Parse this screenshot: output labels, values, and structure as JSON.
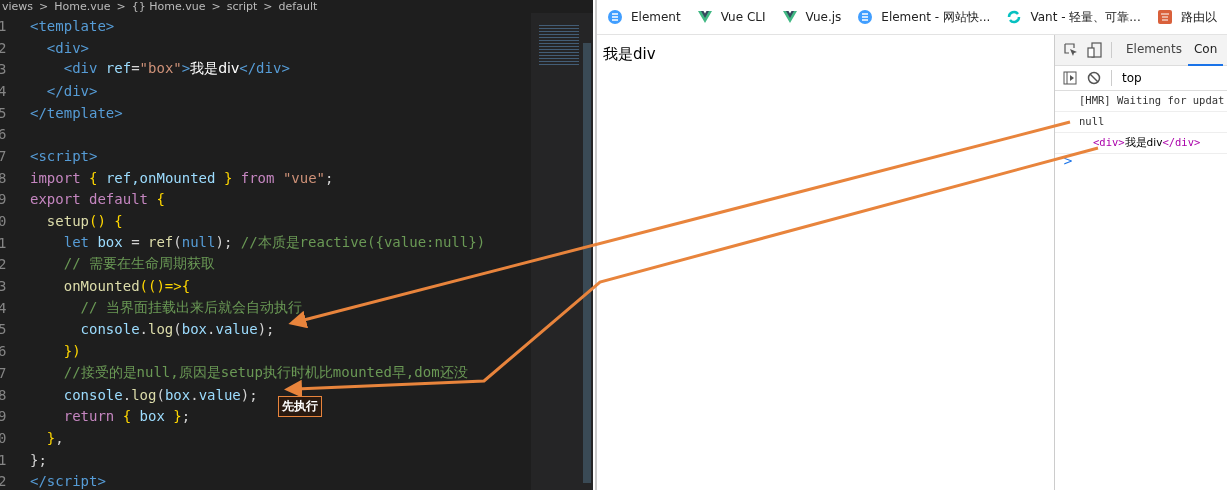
{
  "editor": {
    "breadcrumb": [
      "views",
      ">",
      "Home.vue",
      ">",
      "{} Home.vue",
      ">",
      "script",
      ">",
      "default"
    ],
    "lines": [
      {
        "number": "1",
        "tokens": [
          {
            "kind": "tag",
            "text": "<template>"
          }
        ]
      },
      {
        "number": "2",
        "tokens": [
          {
            "kind": "tag",
            "text": "  <div>"
          }
        ]
      },
      {
        "number": "3",
        "tokens": [
          {
            "kind": "tag",
            "text": "    <div "
          },
          {
            "kind": "attr",
            "text": "ref"
          },
          {
            "kind": "plain",
            "text": "="
          },
          {
            "kind": "str",
            "text": "\"box\""
          },
          {
            "kind": "tag",
            "text": ">"
          },
          {
            "kind": "text",
            "text": "我是div"
          },
          {
            "kind": "tag",
            "text": "</div>"
          }
        ]
      },
      {
        "number": "4",
        "tokens": [
          {
            "kind": "tag",
            "text": "  </div>"
          }
        ]
      },
      {
        "number": "5",
        "tokens": [
          {
            "kind": "tag",
            "text": "</template>"
          }
        ]
      },
      {
        "number": "6"
      },
      {
        "number": "7",
        "tokens": [
          {
            "kind": "tag",
            "text": "<script>"
          }
        ]
      },
      {
        "number": "8",
        "tokens": [
          {
            "kind": "kw",
            "text": "import "
          },
          {
            "kind": "brace",
            "text": "{ "
          },
          {
            "kind": "var",
            "text": "ref,onMounted "
          },
          {
            "kind": "brace",
            "text": "} "
          },
          {
            "kind": "kw",
            "text": "from "
          },
          {
            "kind": "str",
            "text": "\"vue\""
          },
          {
            "kind": "plain",
            "text": ";"
          }
        ]
      },
      {
        "number": "9",
        "tokens": [
          {
            "kind": "kw",
            "text": "export default "
          },
          {
            "kind": "brace",
            "text": "{"
          }
        ]
      },
      {
        "number": "0",
        "tokens": [
          {
            "kind": "fn",
            "text": "  setup"
          },
          {
            "kind": "brace",
            "text": "() {"
          }
        ]
      },
      {
        "number": "1",
        "tokens": [
          {
            "kind": "tag",
            "text": "    let "
          },
          {
            "kind": "var",
            "text": "box "
          },
          {
            "kind": "plain",
            "text": "= "
          },
          {
            "kind": "fn",
            "text": "ref"
          },
          {
            "kind": "plain",
            "text": "("
          },
          {
            "kind": "tag",
            "text": "null"
          },
          {
            "kind": "plain",
            "text": "); "
          },
          {
            "kind": "comment",
            "text": "//本质是reactive({value:null})"
          }
        ]
      },
      {
        "number": "2",
        "tokens": [
          {
            "kind": "comment",
            "text": "    // 需要在生命周期获取"
          }
        ]
      },
      {
        "number": "3",
        "tokens": [
          {
            "kind": "fn",
            "text": "    onMounted"
          },
          {
            "kind": "brace",
            "text": "(()=>{"
          }
        ]
      },
      {
        "number": "4",
        "tokens": [
          {
            "kind": "comment",
            "text": "      // 当界面挂载出来后就会自动执行"
          }
        ]
      },
      {
        "number": "5",
        "tokens": [
          {
            "kind": "var",
            "text": "      console"
          },
          {
            "kind": "plain",
            "text": "."
          },
          {
            "kind": "fn",
            "text": "log"
          },
          {
            "kind": "plain",
            "text": "("
          },
          {
            "kind": "var",
            "text": "box"
          },
          {
            "kind": "plain",
            "text": "."
          },
          {
            "kind": "var",
            "text": "value"
          },
          {
            "kind": "plain",
            "text": ");"
          }
        ]
      },
      {
        "number": "6",
        "tokens": [
          {
            "kind": "brace",
            "text": "    })"
          }
        ]
      },
      {
        "number": "7",
        "tokens": [
          {
            "kind": "comment",
            "text": "    //接受的是null,原因是setup执行时机比mounted早,dom还没"
          }
        ]
      },
      {
        "number": "8",
        "tokens": [
          {
            "kind": "var",
            "text": "    console"
          },
          {
            "kind": "plain",
            "text": "."
          },
          {
            "kind": "fn",
            "text": "log"
          },
          {
            "kind": "plain",
            "text": "("
          },
          {
            "kind": "var",
            "text": "box"
          },
          {
            "kind": "plain",
            "text": "."
          },
          {
            "kind": "var",
            "text": "value"
          },
          {
            "kind": "plain",
            "text": ");"
          }
        ]
      },
      {
        "number": "9",
        "tokens": [
          {
            "kind": "kw",
            "text": "    return "
          },
          {
            "kind": "brace",
            "text": "{ "
          },
          {
            "kind": "var",
            "text": "box "
          },
          {
            "kind": "brace",
            "text": "}"
          },
          {
            "kind": "plain",
            "text": ";"
          }
        ]
      },
      {
        "number": "0",
        "tokens": [
          {
            "kind": "brace",
            "text": "  }"
          },
          {
            "kind": "plain",
            "text": ","
          }
        ]
      },
      {
        "number": "1",
        "tokens": [
          {
            "kind": "plain",
            "text": "};"
          }
        ]
      },
      {
        "number": "2",
        "tokens": [
          {
            "kind": "tag",
            "text": "</script>"
          }
        ]
      }
    ]
  },
  "browser": {
    "bookmarks": [
      {
        "label": "Element",
        "kind": "element"
      },
      {
        "label": "Vue CLI",
        "kind": "vue"
      },
      {
        "label": "Vue.js",
        "kind": "vue"
      },
      {
        "label": "Element - 网站快...",
        "kind": "element"
      },
      {
        "label": "Vant - 轻量、可靠...",
        "kind": "vant"
      },
      {
        "label": "路由以",
        "kind": "doc"
      }
    ],
    "page_text": "我是div",
    "devtools": {
      "tabs": [
        {
          "label": "Elements",
          "selected": false
        },
        {
          "label": "Con",
          "selected": true
        }
      ],
      "context": "top",
      "console": [
        {
          "kind": "log",
          "text": "[HMR] Waiting for updat"
        },
        {
          "kind": "log",
          "text": "null"
        },
        {
          "kind": "element",
          "open": "<div>",
          "content": "我是div",
          "close": "</div>"
        }
      ],
      "prompt": ">"
    }
  },
  "annotation": {
    "label": "先执行"
  }
}
